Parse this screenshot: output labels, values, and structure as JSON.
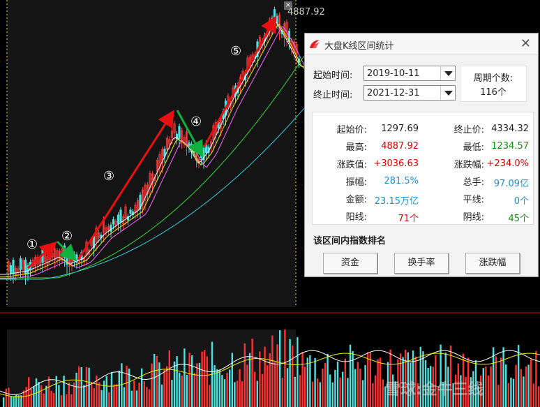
{
  "chart_data": {
    "type": "candlestick",
    "title": "",
    "high_label": "4887.92",
    "wave_labels": [
      "①",
      "②",
      "③",
      "④",
      "⑤"
    ]
  },
  "dialog": {
    "title": "大盘K线区间统计",
    "start_time_label": "起始时间:",
    "start_time": "2019-10-11",
    "end_time_label": "终止时间:",
    "end_time": "2021-12-31",
    "period_label": "周期个数:",
    "period_value": "116个",
    "stats": {
      "start_price_label": "起始价:",
      "start_price": "1297.69",
      "end_price_label": "终止价:",
      "end_price": "4334.32",
      "high_label": "最高:",
      "high": "4887.92",
      "low_label": "最低:",
      "low": "1234.57",
      "change_label": "涨跌值:",
      "change": "+3036.63",
      "pct_label": "涨跌幅:",
      "pct": "+234.0%",
      "amplitude_label": "振幅:",
      "amplitude": "281.5%",
      "volume_label": "总手:",
      "volume": "97.09亿",
      "amount_label": "金额:",
      "amount": "23.15万亿",
      "flat_label": "平线:",
      "flat": "0个",
      "up_label": "阳线:",
      "up": "71个",
      "down_label": "阴线:",
      "down": "45个"
    },
    "rank_title": "该区间内指数排名",
    "buttons": [
      "资金",
      "换手率",
      "涨跌幅"
    ]
  },
  "watermark": "雪球:金牛三线"
}
